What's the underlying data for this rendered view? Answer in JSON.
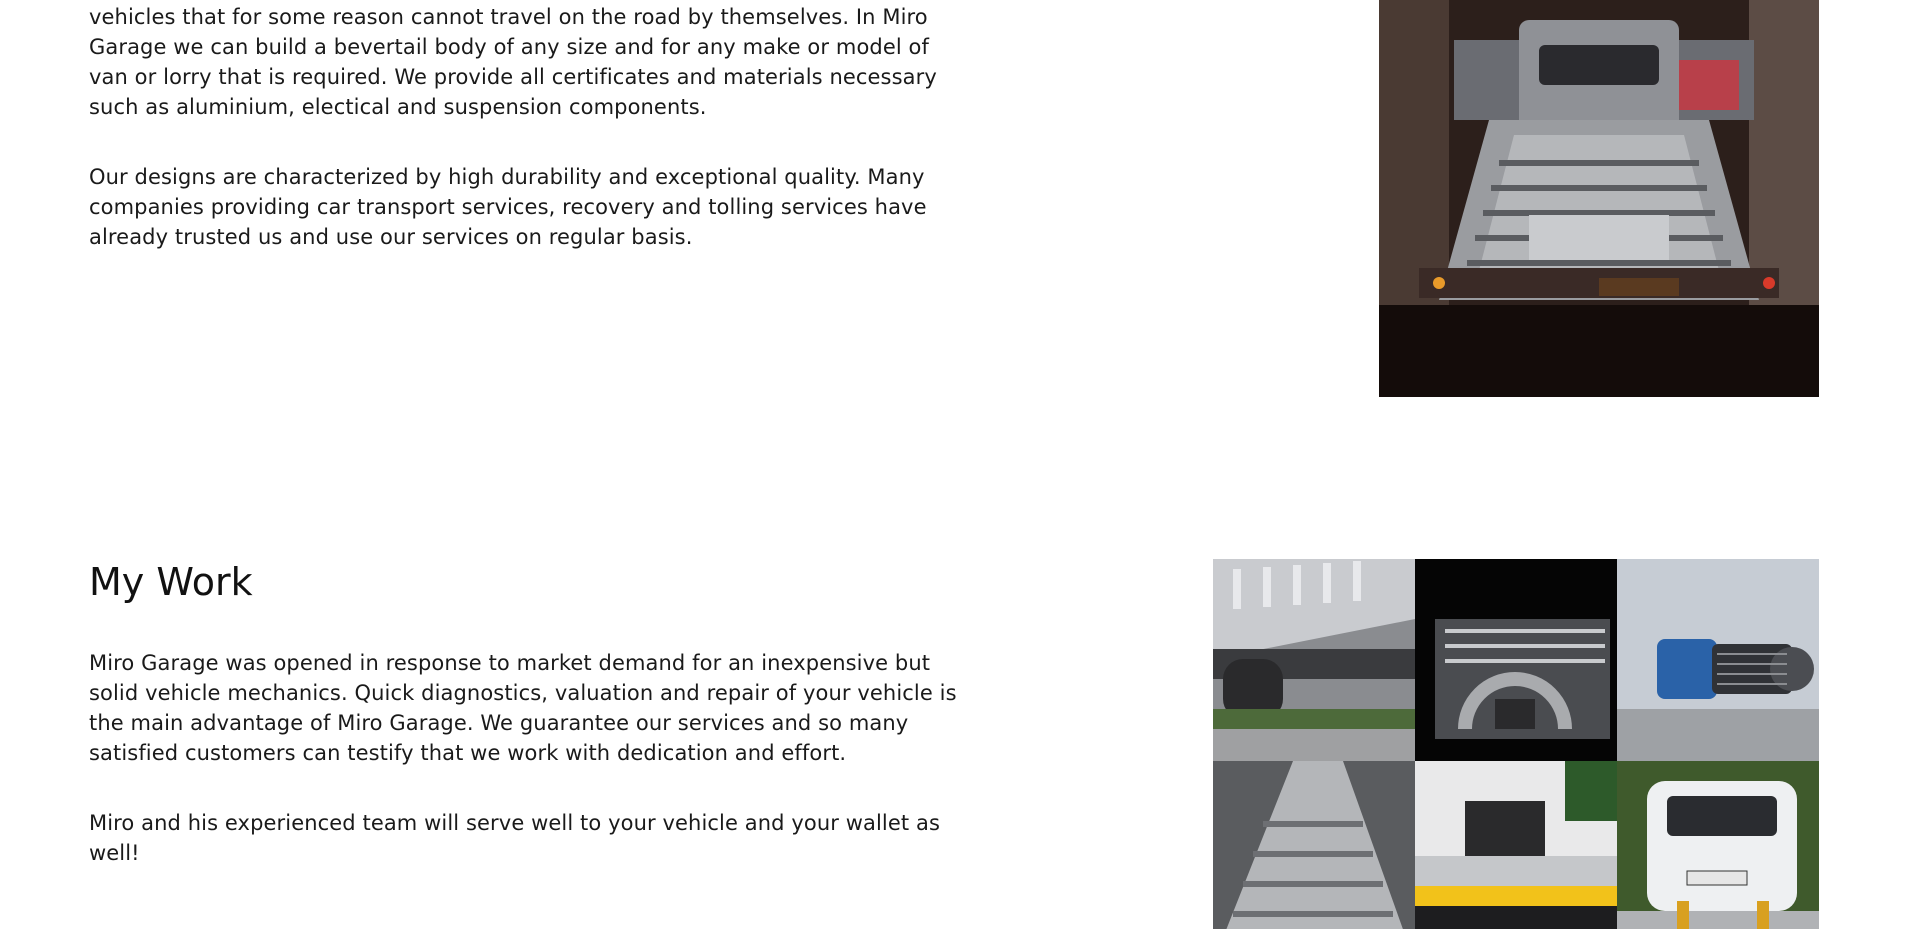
{
  "intro_section": {
    "paragraphs": [
      "vehicles that for some reason cannot travel on the road by themselves. In Miro Garage we can build a bevertail body of any size and for any make or model of van or lorry that is required. We provide all certificates and materials necessary such as aluminium, electical and suspension components.",
      "Our designs are characterized by high durability and exceptional quality. Many companies providing car transport services, recovery and tolling services have already trusted us and use our services on regular basis."
    ]
  },
  "work_section": {
    "title": "My Work",
    "paragraphs": [
      "Miro Garage was opened in response to market demand for an inexpensive but solid vehicle mechanics. Quick diagnostics, valuation and repair of your vehicle is the main advantage of Miro Garage. We guarantee our services and so many satisfied customers can testify that we work with dedication and effort.",
      "Miro and his experienced team will serve well to your vehicle and your wallet as well!"
    ]
  },
  "images": {
    "truck_photo": "tow-truck-bed-photo",
    "gallery": [
      "truck-underside-photo",
      "wheel-arch-detail-photo",
      "winch-photo",
      "aluminium-ramps-photo",
      "truck-bed-equipment-photo",
      "van-on-trailer-photo"
    ]
  },
  "colors": {
    "text": "#1a1a1a",
    "background": "#ffffff"
  }
}
